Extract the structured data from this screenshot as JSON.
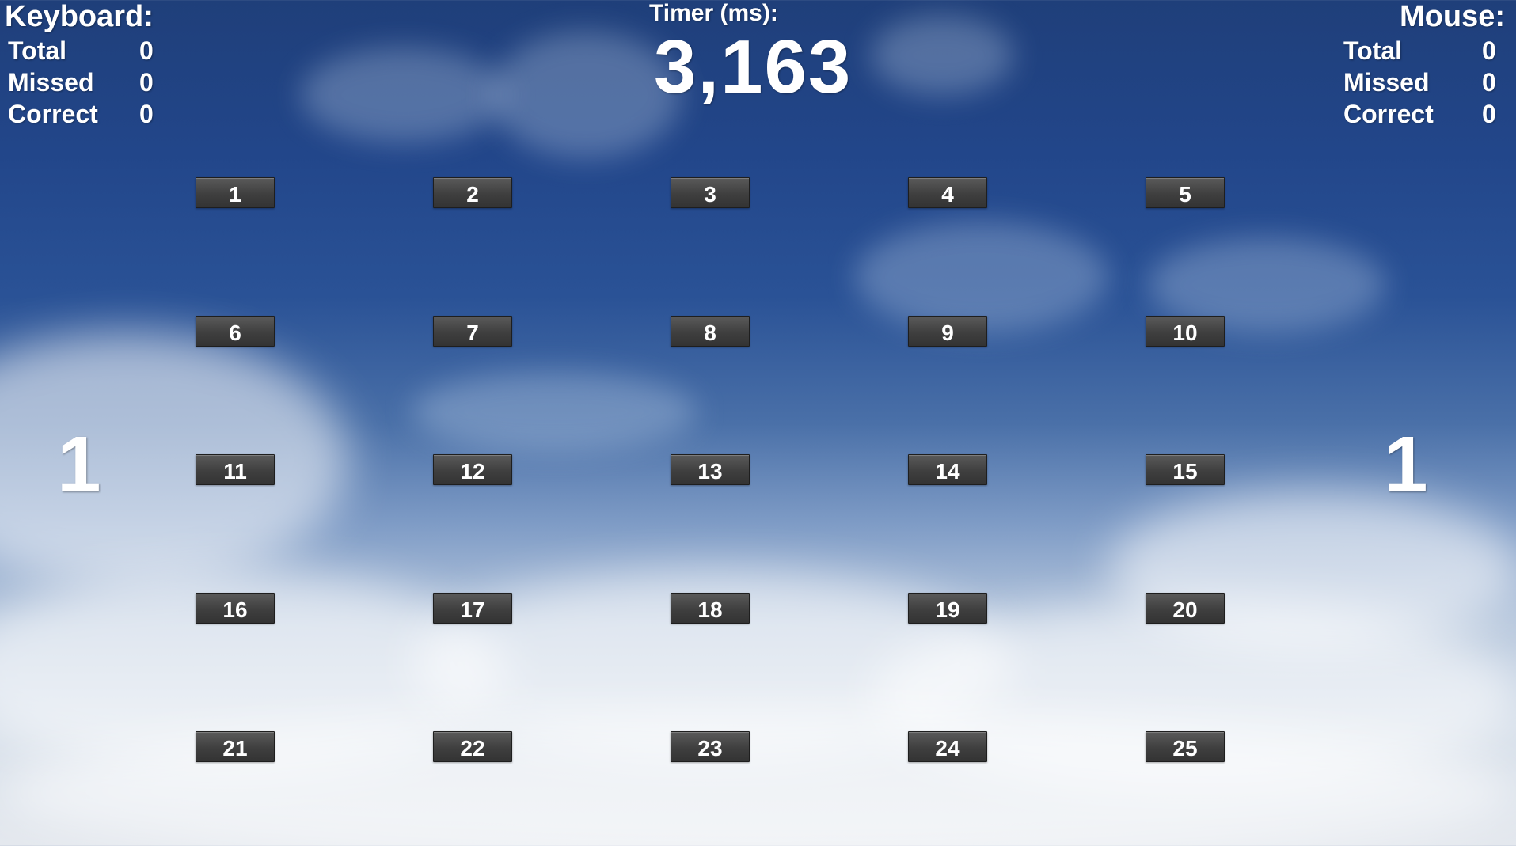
{
  "keyboard": {
    "title": "Keyboard:",
    "stats": [
      {
        "label": "Total",
        "value": "0"
      },
      {
        "label": "Missed",
        "value": "0"
      },
      {
        "label": "Correct",
        "value": "0"
      }
    ],
    "side_count": "1"
  },
  "mouse": {
    "title": "Mouse:",
    "stats": [
      {
        "label": "Total",
        "value": "0"
      },
      {
        "label": "Missed",
        "value": "0"
      },
      {
        "label": "Correct",
        "value": "0"
      }
    ],
    "side_count": "1"
  },
  "timer": {
    "label": "Timer (ms):",
    "value": "3,163"
  },
  "grid": {
    "buttons": [
      "1",
      "2",
      "3",
      "4",
      "5",
      "6",
      "7",
      "8",
      "9",
      "10",
      "11",
      "12",
      "13",
      "14",
      "15",
      "16",
      "17",
      "18",
      "19",
      "20",
      "21",
      "22",
      "23",
      "24",
      "25"
    ]
  }
}
